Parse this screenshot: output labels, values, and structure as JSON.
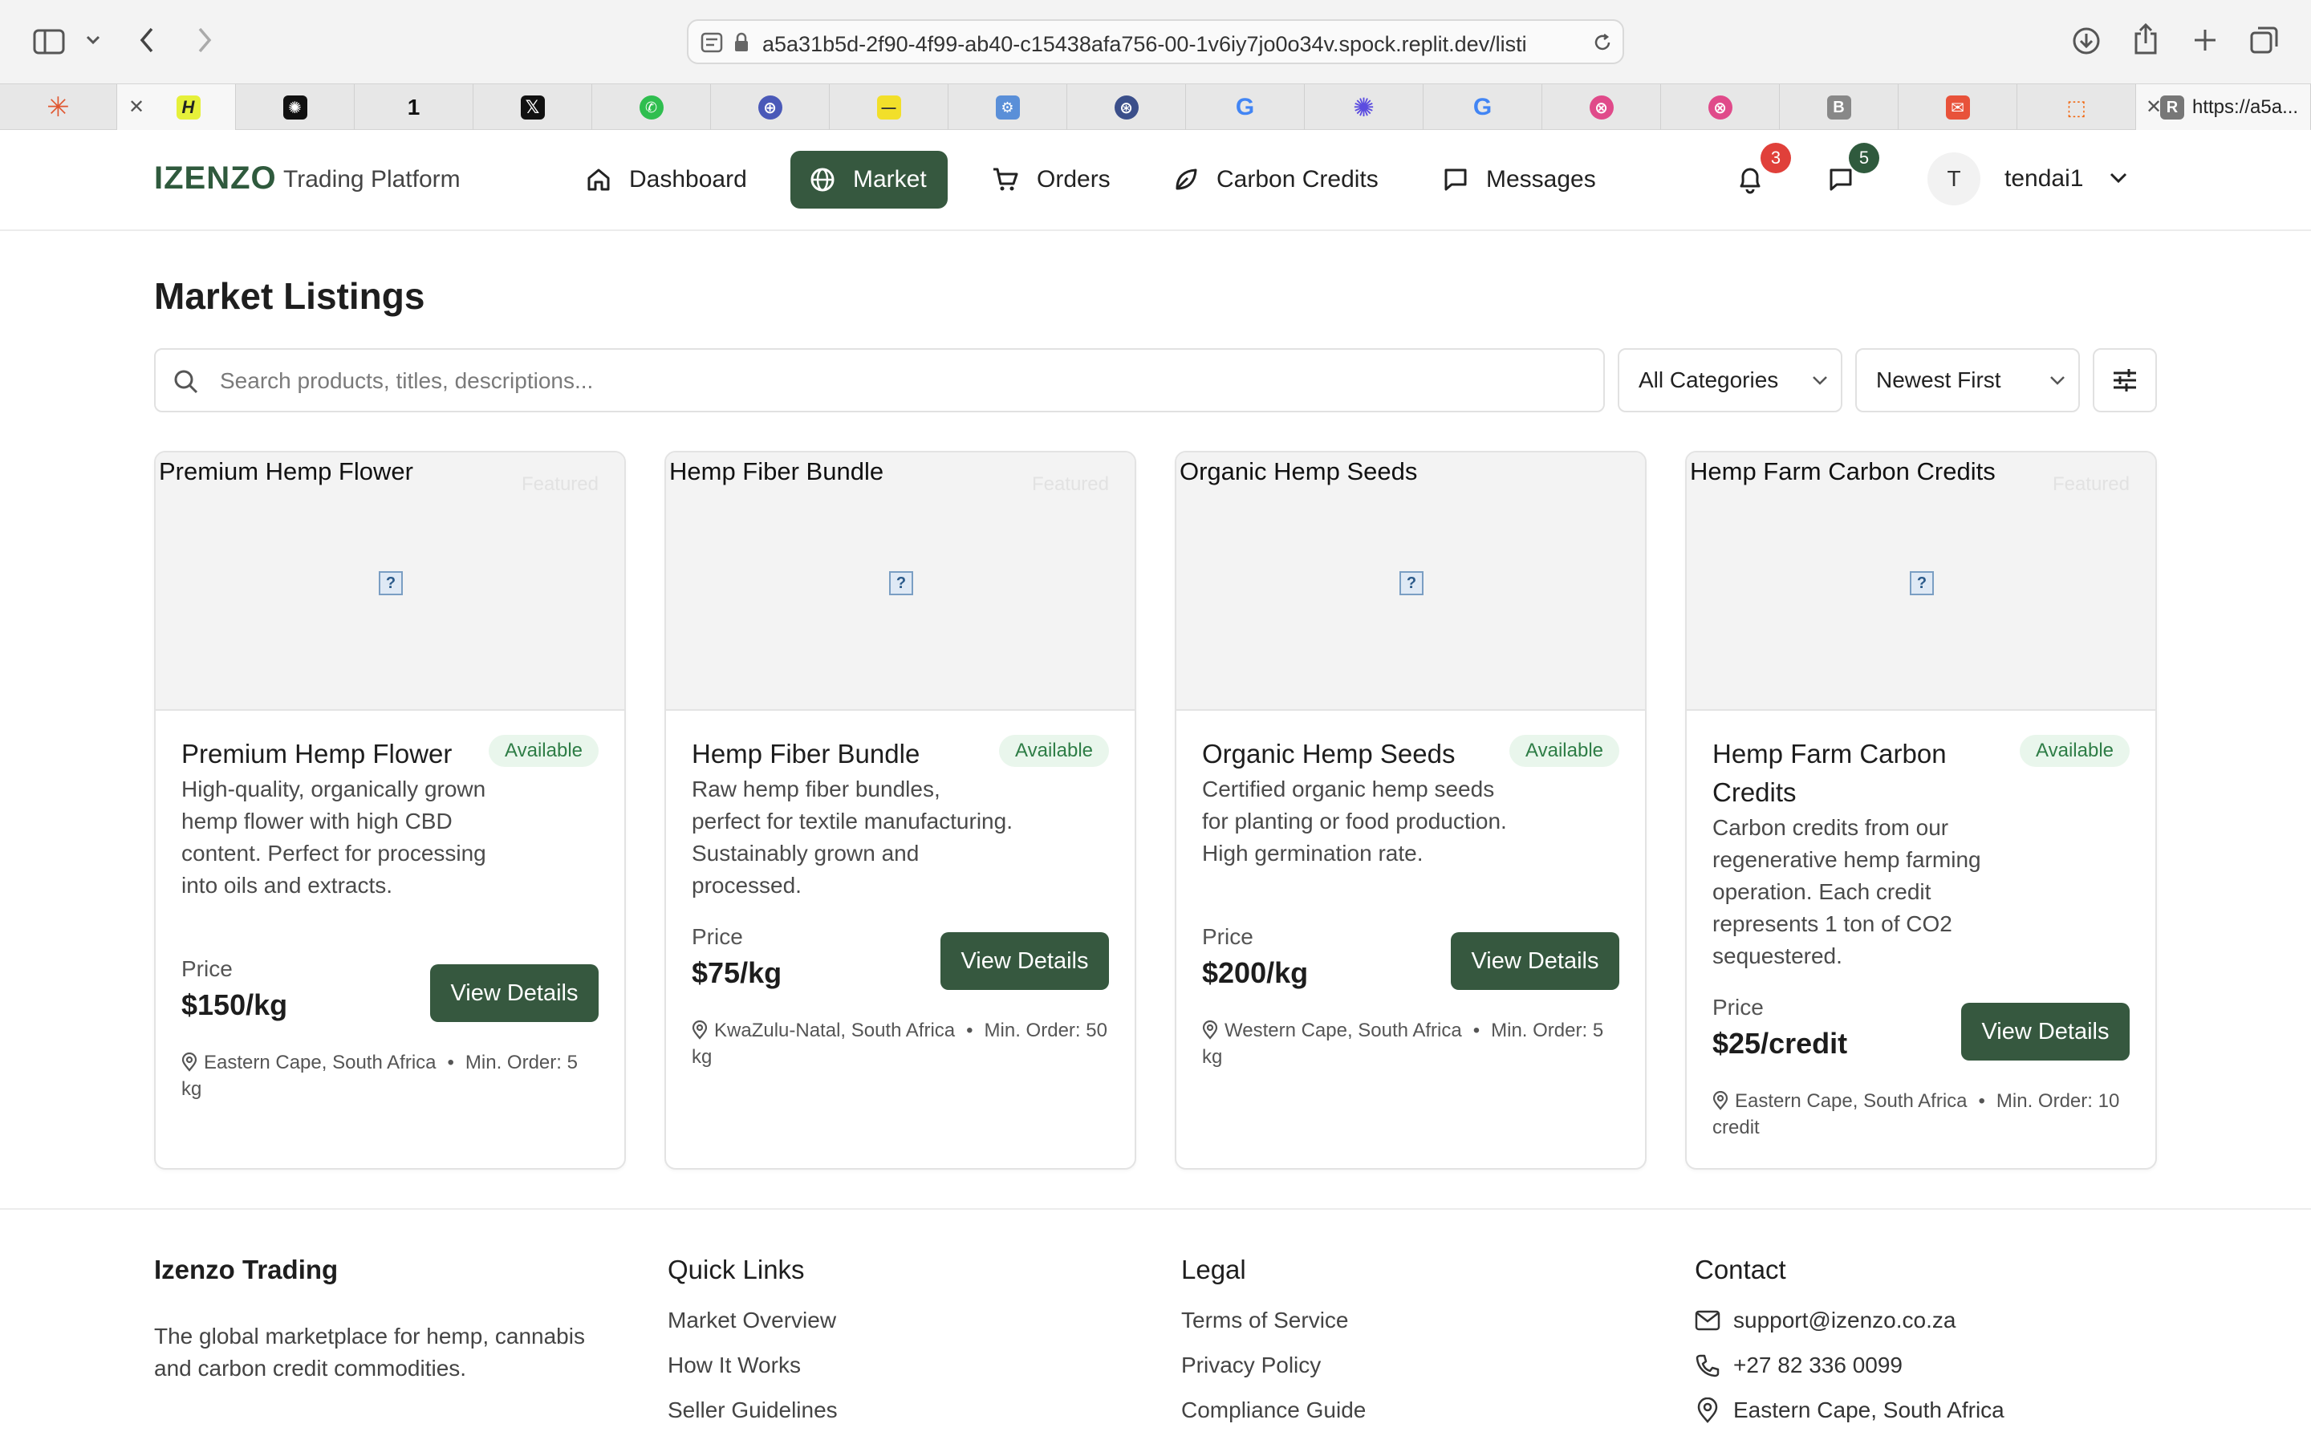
{
  "browser": {
    "url": "a5a31b5d-2f90-4f99-ab40-c15438afa756-00-1v6iy7jo0o34v.spock.replit.dev/listi",
    "last_tab_label": "https://a5a..."
  },
  "header": {
    "brand": "IZENZO",
    "brand_sub": "Trading Platform",
    "nav": {
      "dashboard": "Dashboard",
      "market": "Market",
      "orders": "Orders",
      "carbon": "Carbon Credits",
      "messages": "Messages"
    },
    "notifications_count": "3",
    "messages_count": "5",
    "avatar_initial": "T",
    "username": "tendai1"
  },
  "main": {
    "title": "Market Listings",
    "search_placeholder": "Search products, titles, descriptions...",
    "category_select": "All Categories",
    "sort_select": "Newest First"
  },
  "listings": [
    {
      "alt": "Premium Hemp Flower",
      "featured": "Featured",
      "title": "Premium Hemp Flower",
      "status": "Available",
      "description": "High-quality, organically grown hemp flower with high CBD content. Perfect for processing into oils and extracts.",
      "price_label": "Price",
      "price": "$150/kg",
      "cta": "View Details",
      "location": "Eastern Cape, South Africa",
      "min_order": "Min. Order: 5 kg"
    },
    {
      "alt": "Hemp Fiber Bundle",
      "featured": "Featured",
      "title": "Hemp Fiber Bundle",
      "status": "Available",
      "description": "Raw hemp fiber bundles, perfect for textile manufacturing. Sustainably grown and processed.",
      "price_label": "Price",
      "price": "$75/kg",
      "cta": "View Details",
      "location": "KwaZulu-Natal, South Africa",
      "min_order": "Min. Order: 50 kg"
    },
    {
      "alt": "Organic Hemp Seeds",
      "featured": "",
      "title": "Organic Hemp Seeds",
      "status": "Available",
      "description": "Certified organic hemp seeds for planting or food production. High germination rate.",
      "price_label": "Price",
      "price": "$200/kg",
      "cta": "View Details",
      "location": "Western Cape, South Africa",
      "min_order": "Min. Order: 5 kg"
    },
    {
      "alt": "Hemp Farm Carbon Credits",
      "featured": "Featured",
      "title": "Hemp Farm Carbon Credits",
      "status": "Available",
      "description": "Carbon credits from our regenerative hemp farming operation. Each credit represents 1 ton of CO2 sequestered.",
      "price_label": "Price",
      "price": "$25/credit",
      "cta": "View Details",
      "location": "Eastern Cape, South Africa",
      "min_order": "Min. Order: 10 credit"
    }
  ],
  "footer": {
    "brand": "Izenzo Trading",
    "tagline": "The global marketplace for hemp, cannabis and carbon credit commodities.",
    "quick_links_heading": "Quick Links",
    "quick_links": [
      "Market Overview",
      "How It Works",
      "Seller Guidelines"
    ],
    "legal_heading": "Legal",
    "legal_links": [
      "Terms of Service",
      "Privacy Policy",
      "Compliance Guide"
    ],
    "contact_heading": "Contact",
    "email": "support@izenzo.co.za",
    "phone": "+27 82 336 0099",
    "address": "Eastern Cape, South Africa"
  },
  "colors": {
    "brand_green": "#36583f",
    "logo_green": "#2f5a3d",
    "badge_red": "#e0403a",
    "badge_green": "#2f5a3d",
    "available_bg": "#e9f6ec",
    "available_text": "#2e7d46"
  }
}
